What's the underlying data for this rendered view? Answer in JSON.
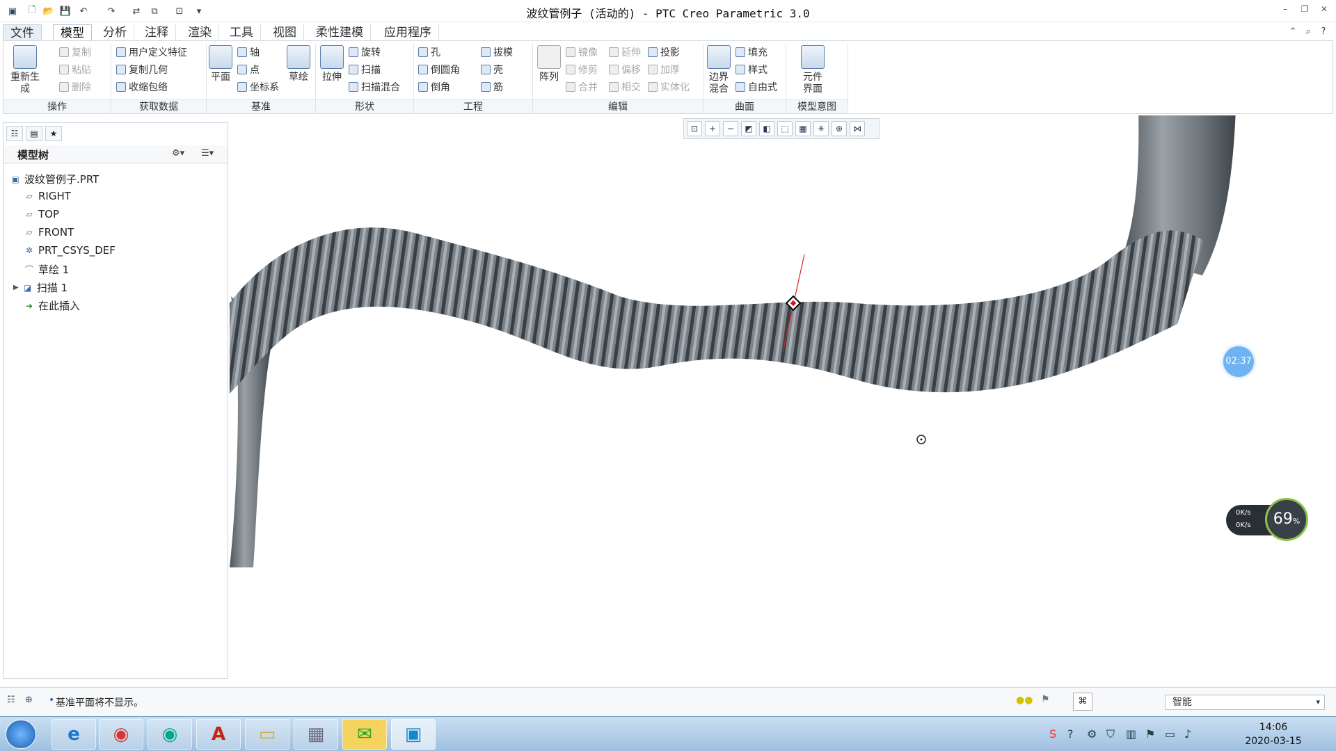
{
  "window": {
    "title": "波纹管例子 (活动的) - PTC Creo Parametric 3.0"
  },
  "quick_access": {
    "icons": [
      "window-menu-icon",
      "new-icon",
      "open-icon",
      "save-icon",
      "undo-icon",
      "redo-icon",
      "regenerate-icon",
      "windows-icon",
      "close-window-icon",
      "customize-icon"
    ]
  },
  "menu_tabs": [
    "文件",
    "模型",
    "分析",
    "注释",
    "渲染",
    "工具",
    "视图",
    "柔性建模",
    "应用程序"
  ],
  "active_tab": "模型",
  "ribbon": {
    "operations": {
      "regenerate": "重新生成",
      "copy": "复制",
      "paste": "粘贴",
      "delete": "删除",
      "group": "操作"
    },
    "get_data": {
      "udf": "用户定义特征",
      "copy_geom": "复制几何",
      "shrinkwrap": "收缩包络",
      "group": "获取数据"
    },
    "datum": {
      "plane": "平面",
      "axis": "轴",
      "point": "点",
      "csys": "坐标系",
      "sketch": "草绘",
      "group": "基准"
    },
    "shapes": {
      "extrude": "拉伸",
      "revolve": "旋转",
      "sweep": "扫描",
      "swept_blend": "扫描混合",
      "group": "形状"
    },
    "engineering": {
      "hole": "孔",
      "round": "倒圆角",
      "chamfer": "倒角",
      "draft": "拔模",
      "shell": "壳",
      "rib": "筋",
      "group": "工程"
    },
    "editing": {
      "pattern": "阵列",
      "mirror": "镜像",
      "trim": "修剪",
      "merge": "合并",
      "extend": "延伸",
      "offset": "偏移",
      "intersect": "相交",
      "project": "投影",
      "thicken": "加厚",
      "solidify": "实体化",
      "group": "编辑"
    },
    "surfaces": {
      "boundary_blend": "边界混合",
      "fill": "填充",
      "style": "样式",
      "freestyle": "自由式",
      "group": "曲面"
    },
    "model_intent": {
      "component_interface": "元件界面",
      "group": "模型意图"
    }
  },
  "model_tree": {
    "header": "模型树",
    "nodes": [
      {
        "label": "波纹管例子.PRT",
        "icon": "part-icon"
      },
      {
        "label": "RIGHT",
        "icon": "datum-plane-icon"
      },
      {
        "label": "TOP",
        "icon": "datum-plane-icon"
      },
      {
        "label": "FRONT",
        "icon": "datum-plane-icon"
      },
      {
        "label": "PRT_CSYS_DEF",
        "icon": "csys-icon"
      },
      {
        "label": "草绘 1",
        "icon": "sketch-icon"
      },
      {
        "label": "扫描 1",
        "icon": "sweep-icon"
      },
      {
        "label": "在此插入",
        "icon": "insert-here-icon"
      }
    ]
  },
  "view_toolbar": {
    "icons": [
      "refit-icon",
      "zoom-in-icon",
      "zoom-out-icon",
      "repaint-icon",
      "display-style-icon",
      "saved-orientations-icon",
      "view-manager-icon",
      "datum-display-icon",
      "spin-center-icon",
      "annotation-display-icon"
    ]
  },
  "status_bar": {
    "message": "基准平面将不显示。",
    "selection_filter": "智能"
  },
  "overlays": {
    "timer": "02:37",
    "upload_rate": "0K/s",
    "download_rate": "0K/s",
    "cpu_percent": "69",
    "percent_sign": "%"
  },
  "taskbar": {
    "time": "14:06",
    "date": "2020-03-15"
  },
  "colors": {
    "pipe": "#6b7278",
    "accent": "#3a6ea5"
  }
}
